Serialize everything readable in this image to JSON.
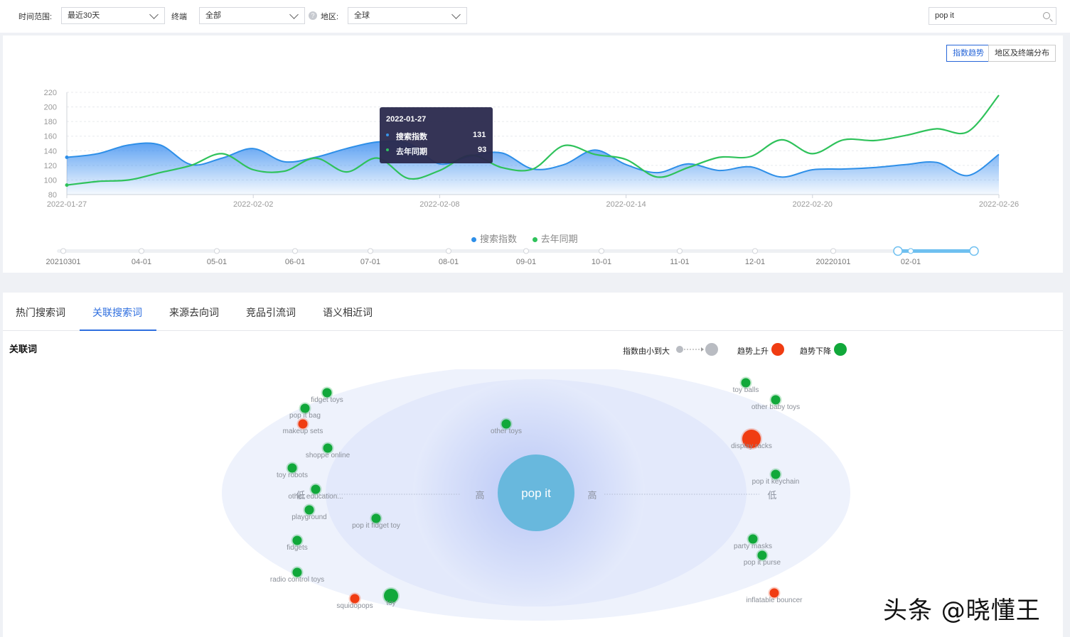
{
  "filters": {
    "time_label": "时间范围:",
    "time_value": "最近30天",
    "terminal_label": "终端",
    "terminal_value": "全部",
    "region_label": "地区:",
    "region_value": "全球",
    "search_value": "pop it"
  },
  "view_tabs": {
    "trend": "指数趋势",
    "region": "地区及终端分布"
  },
  "chart_data": {
    "type": "area",
    "x": [
      "2022-01-27",
      "2022-01-28",
      "2022-01-29",
      "2022-01-30",
      "2022-01-31",
      "2022-02-01",
      "2022-02-02",
      "2022-02-03",
      "2022-02-04",
      "2022-02-05",
      "2022-02-06",
      "2022-02-07",
      "2022-02-08",
      "2022-02-09",
      "2022-02-10",
      "2022-02-11",
      "2022-02-12",
      "2022-02-13",
      "2022-02-14",
      "2022-02-15",
      "2022-02-16",
      "2022-02-17",
      "2022-02-18",
      "2022-02-19",
      "2022-02-20",
      "2022-02-21",
      "2022-02-22",
      "2022-02-23",
      "2022-02-24",
      "2022-02-25",
      "2022-02-26"
    ],
    "xticks": [
      "2022-01-27",
      "2022-02-02",
      "2022-02-08",
      "2022-02-14",
      "2022-02-20",
      "2022-02-26"
    ],
    "yticks": [
      80,
      100,
      120,
      140,
      160,
      180,
      200,
      220
    ],
    "ylim": [
      80,
      220
    ],
    "series": [
      {
        "name": "搜索指数",
        "color": "#2e8fe8",
        "values": [
          131,
          136,
          148,
          148,
          121,
          130,
          143,
          125,
          131,
          143,
          152,
          150,
          122,
          133,
          137,
          115,
          121,
          141,
          121,
          110,
          122,
          113,
          118,
          104,
          114,
          115,
          117,
          121,
          124,
          106,
          135
        ]
      },
      {
        "name": "去年同期",
        "color": "#2fc25b",
        "values": [
          93,
          98,
          100,
          110,
          120,
          136,
          114,
          112,
          130,
          111,
          130,
          102,
          113,
          134,
          117,
          115,
          147,
          135,
          128,
          104,
          117,
          131,
          132,
          155,
          136,
          155,
          154,
          161,
          170,
          166,
          216
        ]
      }
    ],
    "tooltip": {
      "date": "2022-01-27",
      "rows": [
        {
          "name": "搜索指数",
          "value": "131"
        },
        {
          "name": "去年同期",
          "value": "93"
        }
      ]
    }
  },
  "timeline": {
    "labels": [
      "20210301",
      "04-01",
      "05-01",
      "06-01",
      "07-01",
      "08-01",
      "09-01",
      "10-01",
      "11-01",
      "12-01",
      "20220101",
      "02-01"
    ]
  },
  "tabs": [
    "热门搜索词",
    "关联搜索词",
    "来源去向词",
    "竞品引流词",
    "语义相近词"
  ],
  "related": {
    "title": "关联词",
    "legend_size": "指数由小到大",
    "legend_up": "趋势上升",
    "legend_down": "趋势下降",
    "center": "pop it",
    "high": "高",
    "low": "低",
    "colors": {
      "up": "#f03c12",
      "down": "#11a83a"
    },
    "bubbles": [
      {
        "label": "fidget toys",
        "trend": "down",
        "size": "small"
      },
      {
        "label": "pop it bag",
        "trend": "down",
        "size": "small"
      },
      {
        "label": "makeup sets",
        "trend": "up",
        "size": "small"
      },
      {
        "label": "shoppe online",
        "trend": "down",
        "size": "small"
      },
      {
        "label": "toy robots",
        "trend": "down",
        "size": "small"
      },
      {
        "label": "other education...",
        "trend": "down",
        "size": "small"
      },
      {
        "label": "playground",
        "trend": "down",
        "size": "small"
      },
      {
        "label": "pop it fidget toy",
        "trend": "down",
        "size": "small"
      },
      {
        "label": "fidgets",
        "trend": "down",
        "size": "small"
      },
      {
        "label": "radio control toys",
        "trend": "down",
        "size": "small"
      },
      {
        "label": "squidopops",
        "trend": "up",
        "size": "small"
      },
      {
        "label": "toy",
        "trend": "down",
        "size": "medium"
      },
      {
        "label": "other toys",
        "trend": "down",
        "size": "small"
      },
      {
        "label": "toy balls",
        "trend": "down",
        "size": "small"
      },
      {
        "label": "other baby toys",
        "trend": "down",
        "size": "small"
      },
      {
        "label": "display racks",
        "trend": "up",
        "size": "large"
      },
      {
        "label": "pop it keychain",
        "trend": "down",
        "size": "small"
      },
      {
        "label": "party masks",
        "trend": "down",
        "size": "small"
      },
      {
        "label": "pop it purse",
        "trend": "down",
        "size": "small"
      },
      {
        "label": "inflatable bouncer",
        "trend": "up",
        "size": "small"
      }
    ]
  },
  "watermark": "头条 @晓懂王"
}
